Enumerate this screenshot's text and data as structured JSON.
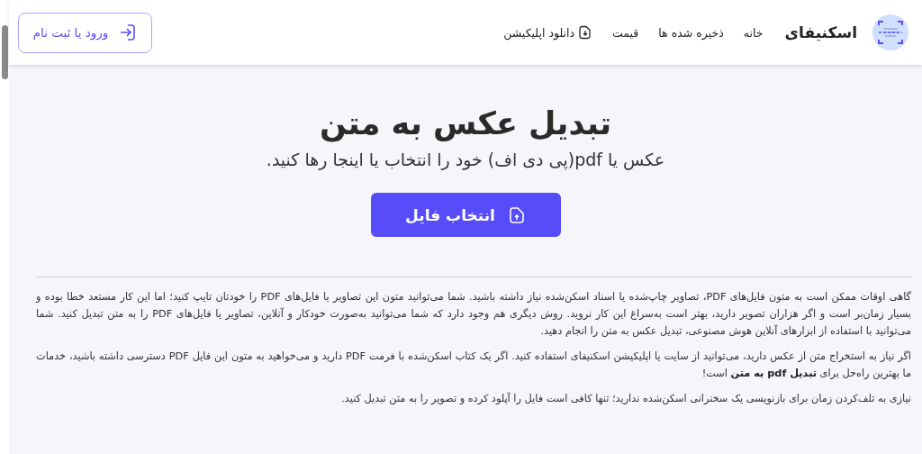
{
  "header": {
    "brand": "اسکنیفای",
    "nav": [
      {
        "label": "خانه",
        "kind": "link"
      },
      {
        "label": "ذخیره شده ها",
        "kind": "link"
      },
      {
        "label": "قیمت",
        "kind": "link"
      },
      {
        "label": "دانلود اپلیکیشن",
        "kind": "app"
      }
    ],
    "login_button": "ورود یا ثبت نام"
  },
  "hero": {
    "title": "تبدیل عکس به متن",
    "subtitle": "عکس یا pdf(پی دی اف) خود را انتخاب یا اینجا رها کنید.",
    "upload_button": "انتخاب فایل"
  },
  "paragraphs": [
    "گاهی اوقات ممکن است به متون فایل‌های PDF، تصاویر چاپ‌شده یا اسناد اسکن‌شده نیاز داشته باشید. شما می‌توانید متون این تصاویر یا فایل‌های PDF را خودتان تایپ کنید؛ اما این کار مستعد خطا بوده و بسیار زمان‌بر است و اگر هزاران تصویر دارید، بهتر است به‌سراغ این کار نروید. روش دیگری هم وجود دارد که شما می‌توانید به‌صورت خودکار و آنلاین، تصاویر یا فایل‌های PDF را به متن تبدیل کنید. شما می‌توانید با استفاده از ابزارهای آنلاین هوش مصنوعی، تبدیل عکس به متن را انجام دهید.",
    "اگر نیاز به استخراج متن از عکس دارید، می‌توانید از سایت یا اپلیکیشن اسکنیفای استفاده کنید. اگر یک کتاب اسکن‌شده با فرمت PDF دارید و می‌خواهید به متون این فایل PDF دسترسی داشته باشید، خدمات ما بهترین راه‌حل برای **تبدیل pdf به متن** است!",
    "نیازی به تلف‌کردن زمان برای بازنویسی یک سخنرانی اسکن‌شده ندارید؛ تنها کافی است فایل را آپلود کرده و تصویر را به متن تبدیل کنید."
  ]
}
